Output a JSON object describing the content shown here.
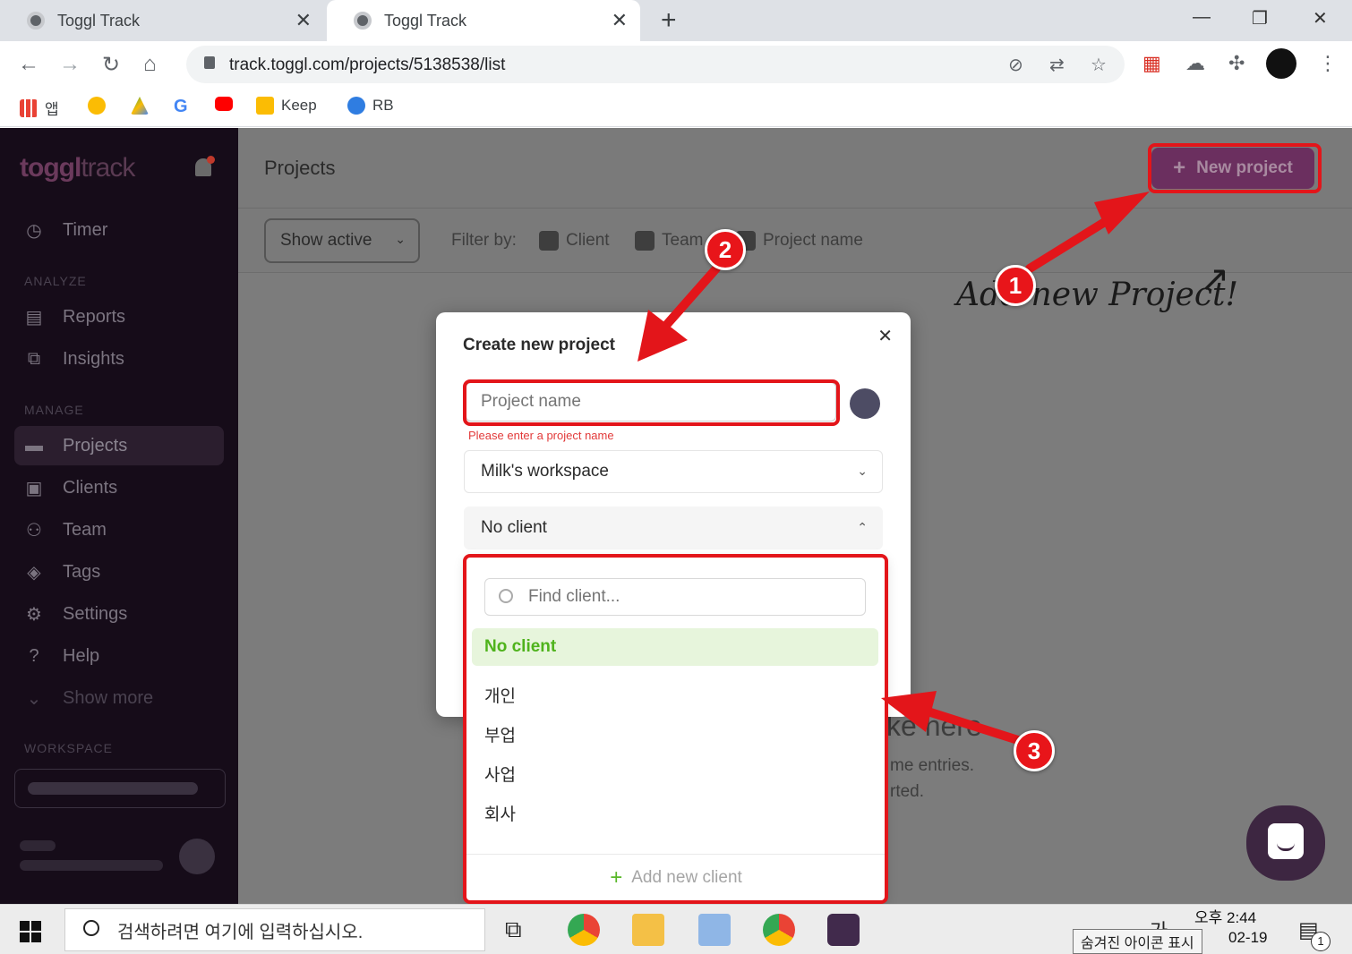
{
  "browser": {
    "tabs": [
      {
        "title": "Toggl Track"
      },
      {
        "title": "Toggl Track"
      }
    ],
    "url": "track.toggl.com/projects/5138538/list",
    "bookmarks": [
      {
        "label": "앱"
      },
      {
        "label": ""
      },
      {
        "label": ""
      },
      {
        "label": ""
      },
      {
        "label": ""
      },
      {
        "label": "Keep"
      },
      {
        "label": "RB"
      }
    ]
  },
  "sidebar": {
    "logo_main": "toggl",
    "logo_sub": "track",
    "timer": "Timer",
    "analyze_label": "ANALYZE",
    "reports": "Reports",
    "insights": "Insights",
    "manage_label": "MANAGE",
    "projects": "Projects",
    "clients": "Clients",
    "team": "Team",
    "tags": "Tags",
    "settings": "Settings",
    "help": "Help",
    "show_more": "Show more",
    "workspace_label": "WORKSPACE"
  },
  "header": {
    "title": "Projects",
    "new_project": "New project"
  },
  "filters": {
    "show_active": "Show active",
    "filter_by": "Filter by:",
    "client": "Client",
    "team": "Team",
    "project_name": "Project name"
  },
  "background": {
    "scribble": "Add new Project!",
    "empty_heading": "ke here",
    "empty_line1": "me entries.",
    "empty_line2": "rted."
  },
  "modal": {
    "title": "Create new project",
    "name_placeholder": "Project name",
    "error": "Please enter a project name",
    "workspace": "Milk's workspace",
    "client": "No client"
  },
  "client_dropdown": {
    "search_placeholder": "Find client...",
    "items": [
      "No client",
      "개인",
      "부업",
      "사업",
      "회사"
    ],
    "selected_index": 0,
    "add_new": "Add new client"
  },
  "annotations": {
    "badge_1": "1",
    "badge_2": "2",
    "badge_3": "3",
    "color": "#e3151a"
  },
  "taskbar": {
    "search": "검색하려면 여기에 입력하십시오.",
    "time": "오후 2:44",
    "date": "02-19",
    "ime": "가",
    "tooltip": "숨겨진 아이콘 표시",
    "notification_count": "1"
  }
}
